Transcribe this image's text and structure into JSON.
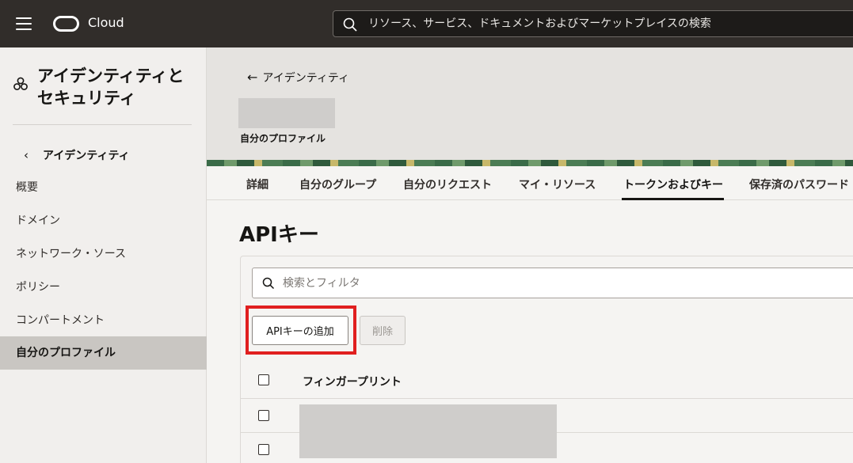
{
  "topbar": {
    "brand": "Cloud",
    "search_placeholder": "リソース、サービス、ドキュメントおよびマーケットプレイスの検索"
  },
  "sidebar": {
    "title": "アイデンティティとセキュリティ",
    "back_label": "アイデンティティ",
    "items": [
      {
        "label": "概要"
      },
      {
        "label": "ドメイン"
      },
      {
        "label": "ネットワーク・ソース"
      },
      {
        "label": "ポリシー"
      },
      {
        "label": "コンパートメント"
      },
      {
        "label": "自分のプロファイル",
        "active": true
      }
    ]
  },
  "header": {
    "back_label": "アイデンティティ",
    "profile_label": "自分のプロファイル"
  },
  "tabs": [
    {
      "label": "詳細"
    },
    {
      "label": "自分のグループ"
    },
    {
      "label": "自分のリクエスト"
    },
    {
      "label": "マイ・リソース"
    },
    {
      "label": "トークンおよびキー",
      "active": true
    },
    {
      "label": "保存済のパスワード"
    }
  ],
  "main": {
    "title": "APIキー",
    "filter_placeholder": "検索とフィルタ",
    "add_button": "APIキーの追加",
    "delete_button": "削除",
    "table": {
      "columns": [
        "フィンガープリント"
      ]
    }
  },
  "colors": {
    "topbar": "#312d2a",
    "highlight": "#e01f1f"
  }
}
